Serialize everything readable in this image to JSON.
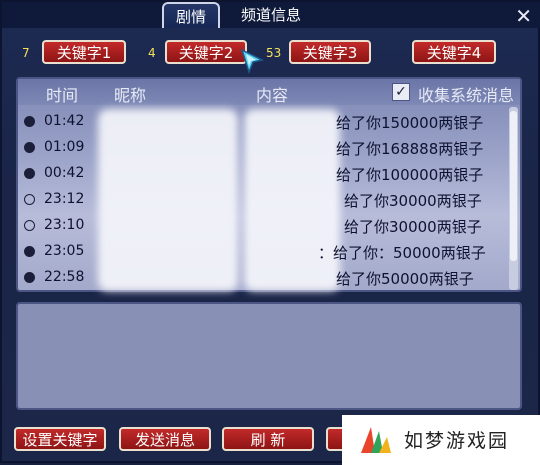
{
  "tabs": [
    {
      "label": "剧情",
      "active": true
    },
    {
      "label": "频道信息",
      "active": false
    }
  ],
  "close_label": "✕",
  "keywords": [
    {
      "count": "7",
      "label": "关键字1"
    },
    {
      "count": "4",
      "label": "关键字2"
    },
    {
      "count": "53",
      "label": "关键字3"
    },
    {
      "count": "",
      "label": "关键字4"
    }
  ],
  "list": {
    "headers": {
      "time": "时间",
      "nickname": "昵称",
      "content": "内容",
      "collect": "收集系统消息"
    },
    "collect_checked": true,
    "check_mark": "✓",
    "rows": [
      {
        "marked": true,
        "time": "01:42",
        "content": "给了你150000两银子"
      },
      {
        "marked": true,
        "time": "01:09",
        "content": "给了你168888两银子"
      },
      {
        "marked": true,
        "time": "00:42",
        "content": "给了你100000两银子"
      },
      {
        "marked": false,
        "time": "23:12",
        "content": "给了你30000两银子"
      },
      {
        "marked": false,
        "time": "23:10",
        "content": "给了你30000两银子"
      },
      {
        "marked": true,
        "time": "23:05",
        "content": "：给了你：50000两银子"
      },
      {
        "marked": true,
        "time": "22:58",
        "content": "给了你50000两银子"
      }
    ]
  },
  "buttons": {
    "set_keyword": "设置关键字",
    "send_message": "发送消息",
    "refresh": "刷 新"
  },
  "watermark": {
    "text": "如梦游戏园"
  },
  "colors": {
    "button_red": "#b01f1f",
    "panel_blue": "#1d2a52",
    "list_bg": "#9aa2c8",
    "keyword_count": "#f5e05a"
  }
}
